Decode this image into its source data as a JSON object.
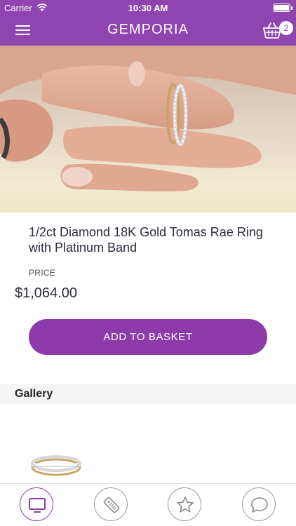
{
  "status_bar": {
    "carrier": "Carrier",
    "time": "10:30 AM"
  },
  "header": {
    "title": "GEMPORIA",
    "basket_count": "2",
    "menu_icon": "hamburger-menu-icon",
    "basket_icon": "shopping-basket-icon"
  },
  "product": {
    "title": "1/2ct Diamond 18K Gold Tomas Rae Ring with Platinum Band",
    "price_label": "PRICE",
    "price": "$1,064.00",
    "add_button_label": "ADD TO BASKET"
  },
  "gallery": {
    "heading": "Gallery"
  },
  "tab_bar": {
    "tabs": [
      {
        "icon": "tv-icon",
        "active": true
      },
      {
        "icon": "remote-control-icon",
        "active": false
      },
      {
        "icon": "star-icon",
        "active": false
      },
      {
        "icon": "chat-bubble-icon",
        "active": false
      }
    ]
  },
  "colors": {
    "brand_purple": "#8e45b0",
    "button_purple": "#8e3aa8"
  }
}
